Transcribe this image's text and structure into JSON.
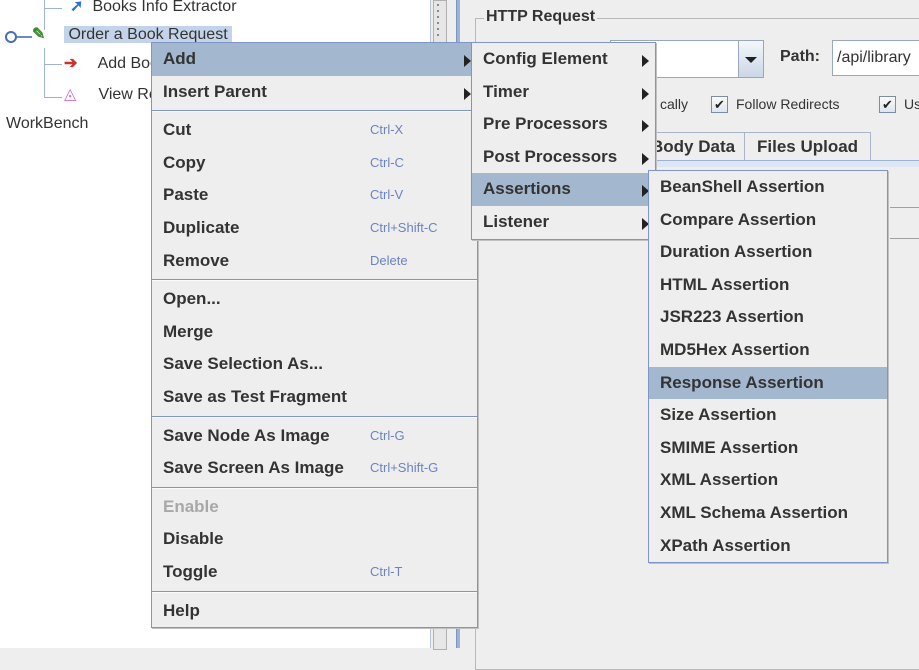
{
  "tree": {
    "items": [
      {
        "label": "Books Info Extractor",
        "icon": "regex-extractor-icon"
      },
      {
        "label": "Order a Book Request",
        "icon": "http-sampler-pipette-icon",
        "selected": true
      },
      {
        "label": "Add Book",
        "icon": "assertion-arrow-icon"
      },
      {
        "label": "View Results",
        "icon": "graph-listener-icon"
      },
      {
        "label": "WorkBench",
        "icon": ""
      }
    ]
  },
  "http_request": {
    "title": "HTTP Request",
    "path_label": "Path:",
    "path_value": "/api/library",
    "checkbox_partial_label": "cally",
    "follow_redirects_label": "Follow Redirects",
    "follow_redirects_checked": true,
    "use_keepalive_partial_label": "Us",
    "use_keepalive_checked": true,
    "tabs": [
      {
        "label": "Body Data"
      },
      {
        "label": "Files Upload"
      }
    ]
  },
  "context_menu": {
    "groups": [
      [
        {
          "label": "Add",
          "submenu": true,
          "highlighted": true
        },
        {
          "label": "Insert Parent",
          "submenu": true
        }
      ],
      [
        {
          "label": "Cut",
          "shortcut": "Ctrl-X"
        },
        {
          "label": "Copy",
          "shortcut": "Ctrl-C"
        },
        {
          "label": "Paste",
          "shortcut": "Ctrl-V"
        },
        {
          "label": "Duplicate",
          "shortcut": "Ctrl+Shift-C"
        },
        {
          "label": "Remove",
          "shortcut": "Delete"
        }
      ],
      [
        {
          "label": "Open..."
        },
        {
          "label": "Merge"
        },
        {
          "label": "Save Selection As..."
        },
        {
          "label": "Save as Test Fragment"
        }
      ],
      [
        {
          "label": "Save Node As Image",
          "shortcut": "Ctrl-G"
        },
        {
          "label": "Save Screen As Image",
          "shortcut": "Ctrl+Shift-G"
        }
      ],
      [
        {
          "label": "Enable",
          "disabled": true
        },
        {
          "label": "Disable"
        },
        {
          "label": "Toggle",
          "shortcut": "Ctrl-T"
        }
      ],
      [
        {
          "label": "Help"
        }
      ]
    ]
  },
  "add_submenu": {
    "items": [
      {
        "label": "Config Element",
        "submenu": true
      },
      {
        "label": "Timer",
        "submenu": true
      },
      {
        "label": "Pre Processors",
        "submenu": true
      },
      {
        "label": "Post Processors",
        "submenu": true
      },
      {
        "label": "Assertions",
        "submenu": true,
        "highlighted": true
      },
      {
        "label": "Listener",
        "submenu": true
      }
    ]
  },
  "assertions_submenu": {
    "items": [
      {
        "label": "BeanShell Assertion"
      },
      {
        "label": "Compare Assertion"
      },
      {
        "label": "Duration Assertion"
      },
      {
        "label": "HTML Assertion"
      },
      {
        "label": "JSR223 Assertion"
      },
      {
        "label": "MD5Hex Assertion"
      },
      {
        "label": "Response Assertion",
        "highlighted": true
      },
      {
        "label": "Size Assertion"
      },
      {
        "label": "SMIME Assertion"
      },
      {
        "label": "XML Assertion"
      },
      {
        "label": "XML Schema Assertion"
      },
      {
        "label": "XPath Assertion"
      }
    ]
  },
  "colors": {
    "menu_highlight": "#a3b8cf",
    "menu_border": "#7f95c8",
    "shortcut_text": "#6b83c2",
    "tree_selection": "#c3d4ea"
  }
}
